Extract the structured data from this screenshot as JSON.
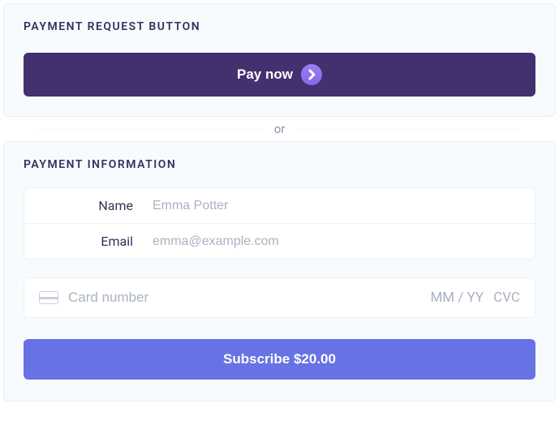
{
  "colors": {
    "pay_button_bg": "#43306f",
    "subscribe_bg": "#6772e5",
    "accent_icon": "#8866e8"
  },
  "payment_request": {
    "title": "PAYMENT REQUEST BUTTON",
    "button_label": "Pay now"
  },
  "divider": {
    "text": "or"
  },
  "payment_info": {
    "title": "PAYMENT INFORMATION",
    "fields": {
      "name": {
        "label": "Name",
        "placeholder": "Emma Potter",
        "value": ""
      },
      "email": {
        "label": "Email",
        "placeholder": "emma@example.com",
        "value": ""
      }
    },
    "card": {
      "placeholder": "Card number",
      "expiry_placeholder": "MM / YY",
      "cvc_placeholder": "CVC"
    },
    "subscribe_label": "Subscribe $20.00"
  }
}
